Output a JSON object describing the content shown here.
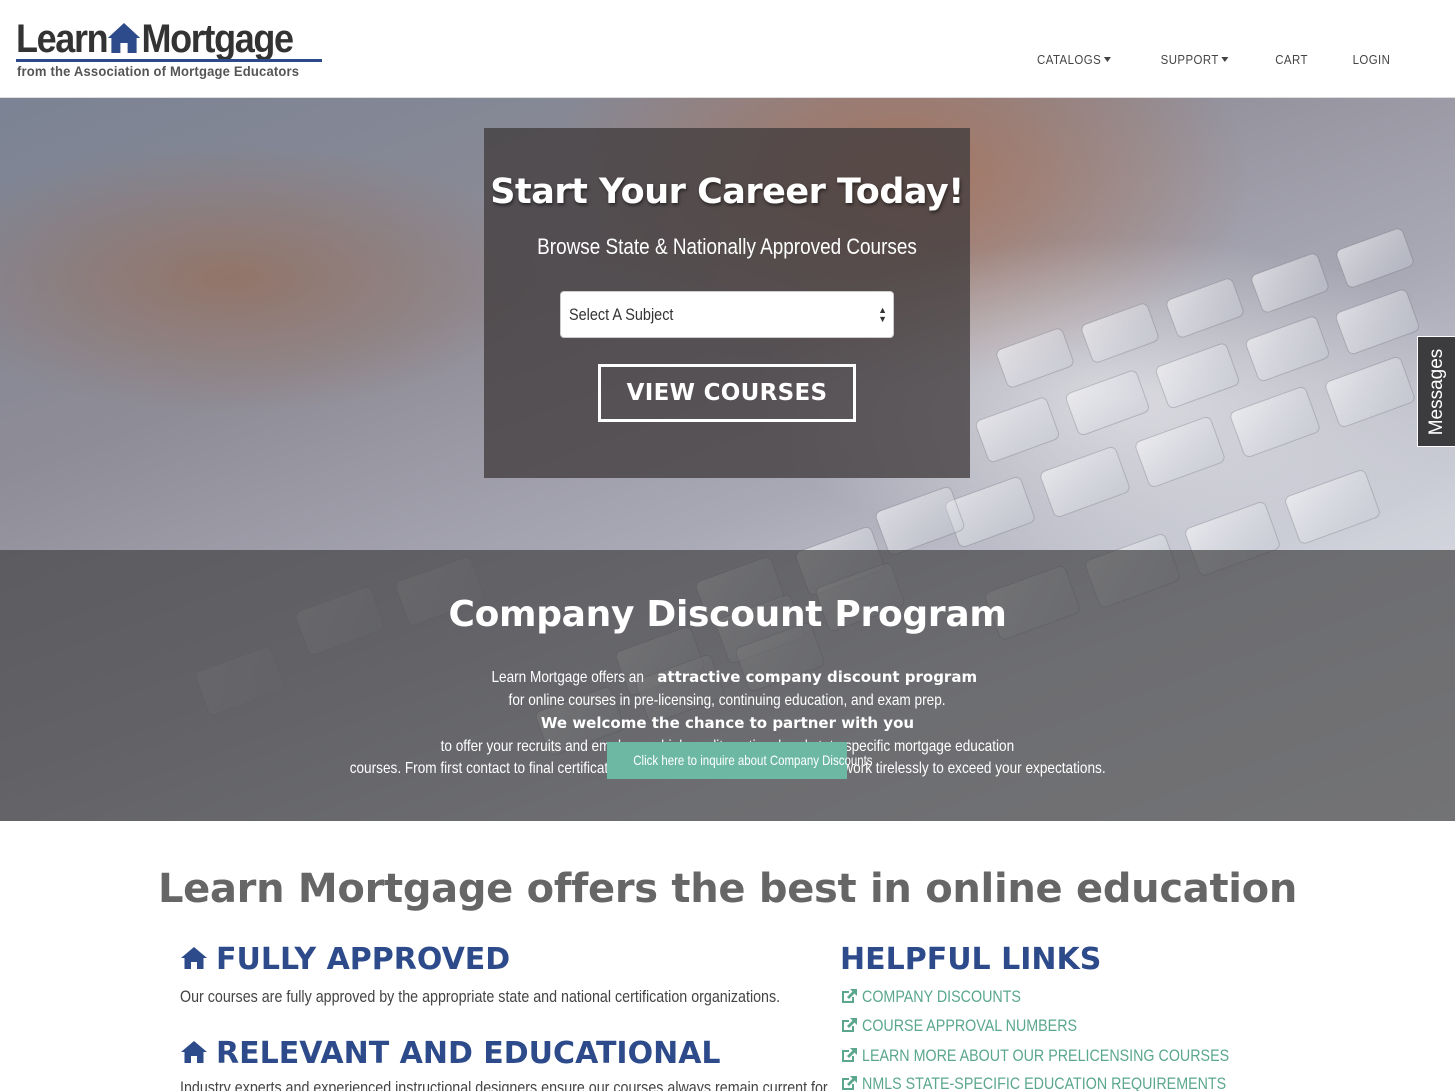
{
  "brand": {
    "logo_left": "Learn",
    "logo_right": "Mortgage",
    "logo_tagline": "from the Association of Mortgage Educators"
  },
  "nav": {
    "catalogs": "CATALOGS",
    "support": "SUPPORT",
    "cart": "CART",
    "login": "LOGIN"
  },
  "hero": {
    "title": "Start Your Career Today!",
    "subtitle": "Browse State & Nationally Approved Courses",
    "select_value": "Select A Subject",
    "button": "VIEW COURSES"
  },
  "messages_tab": "Messages",
  "discount": {
    "title": "Company Discount Program",
    "line1_a": "Learn Mortgage offers an ",
    "line1_b": "attractive company discount program",
    "line1_c": " for online courses in pre-licensing, continuing education, and exam prep.",
    "line2_a": "We welcome the chance to partner with you",
    "line2_b": " to offer your recruits and employees high quality national and state specific mortgage education",
    "line3": "courses. From first contact to final certificates; we understand your needs and will work tirelessly to exceed your expectations.",
    "button": "Click here to inquire about Company Discounts"
  },
  "main": {
    "title": "Learn Mortgage offers the best in online education",
    "features": [
      {
        "title": "FULLY APPROVED",
        "text": "Our courses are fully approved by the appropriate state and national certification organizations."
      },
      {
        "title": "RELEVANT AND EDUCATIONAL",
        "text": "Industry experts and experienced instructional designers ensure our courses always remain current for"
      }
    ],
    "links_title": "HELPFUL LINKS",
    "links": [
      "COMPANY DISCOUNTS",
      "COURSE APPROVAL NUMBERS",
      "LEARN MORE ABOUT OUR PRELICENSING COURSES",
      "NMLS STATE-SPECIFIC EDUCATION REQUIREMENTS"
    ]
  },
  "colors": {
    "brand_blue": "#2d4a8a",
    "accent_green": "#6cb8a2",
    "link_green": "#5aa78e",
    "heading_gray": "#666666"
  }
}
